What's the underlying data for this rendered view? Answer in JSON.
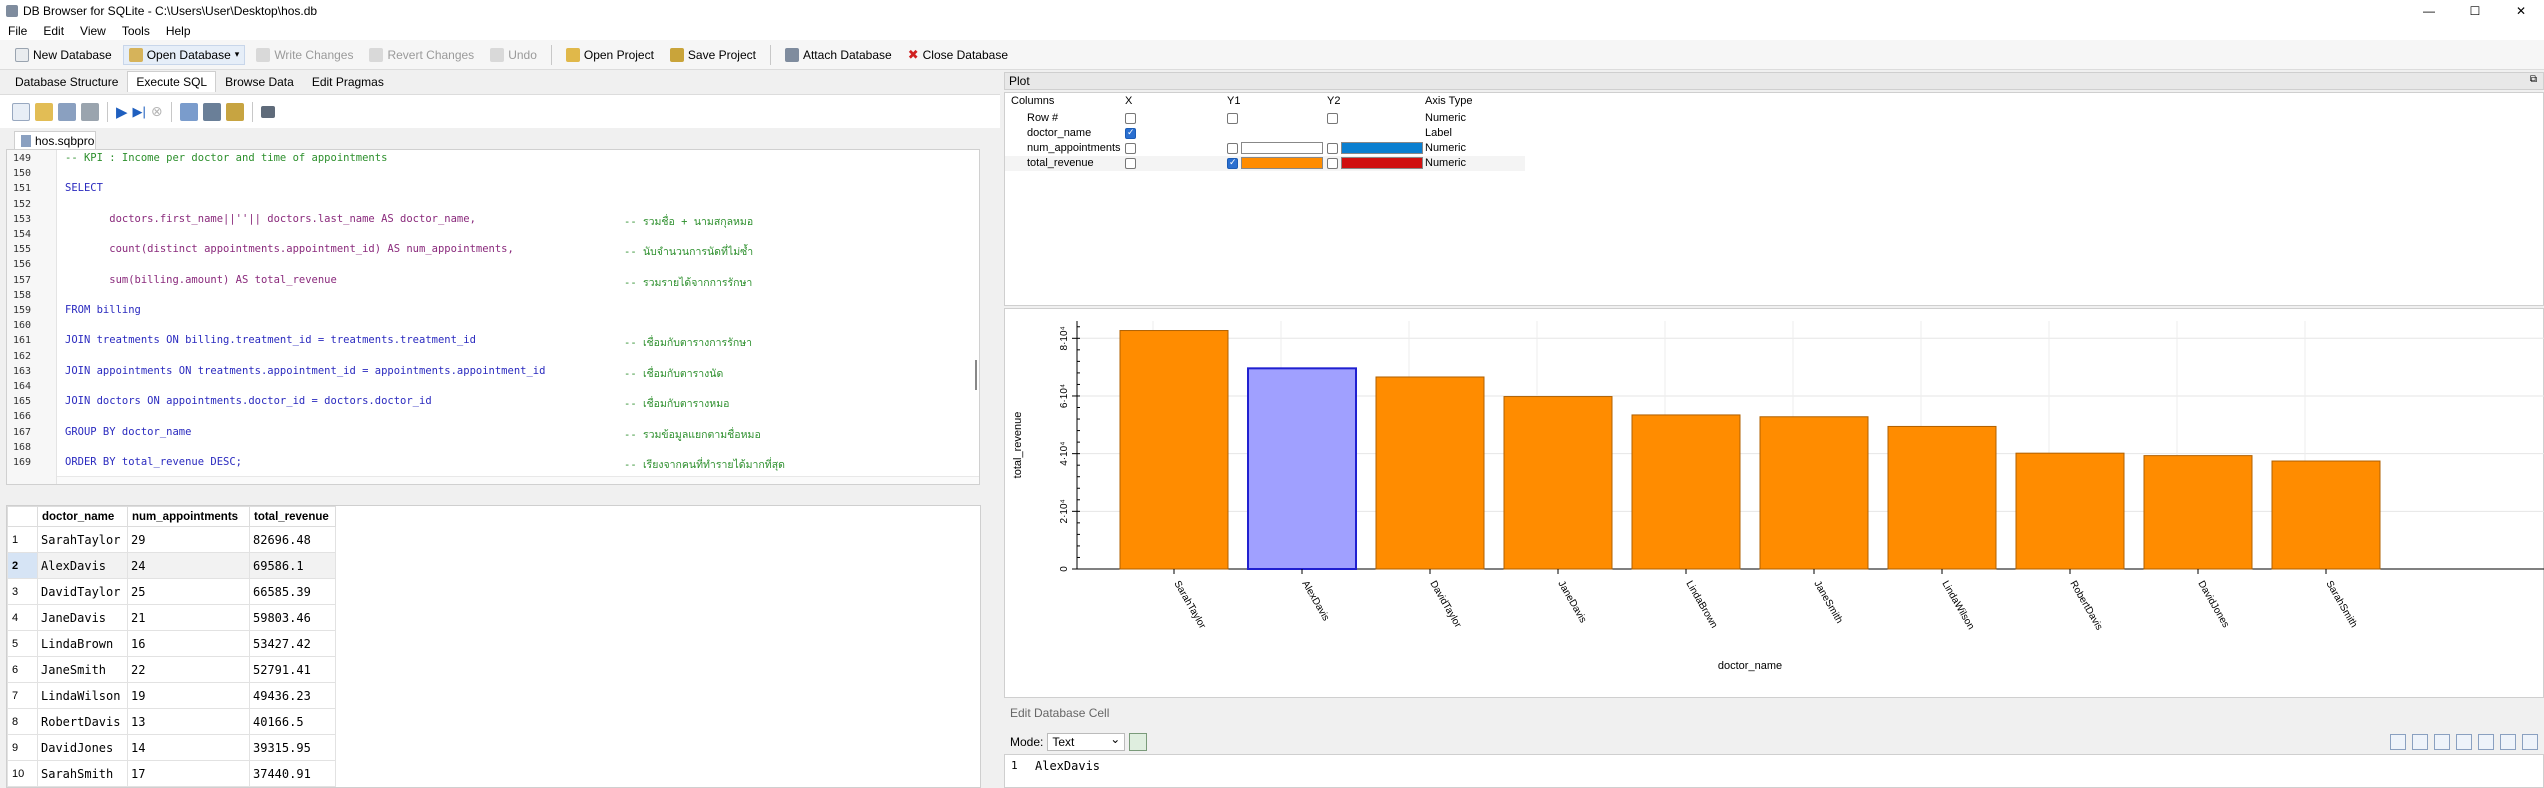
{
  "window": {
    "title": "DB Browser for SQLite - C:\\Users\\User\\Desktop\\hos.db",
    "controls": [
      "—",
      "☐",
      "✕"
    ]
  },
  "menu": [
    "File",
    "Edit",
    "View",
    "Tools",
    "Help"
  ],
  "toolbar": {
    "new_database": "New Database",
    "open_database": "Open Database",
    "write_changes": "Write Changes",
    "revert_changes": "Revert Changes",
    "undo": "Undo",
    "open_project": "Open Project",
    "save_project": "Save Project",
    "attach_database": "Attach Database",
    "close_database": "Close Database"
  },
  "tabs": [
    "Database Structure",
    "Execute SQL",
    "Browse Data",
    "Edit Pragmas"
  ],
  "active_tab": "Execute SQL",
  "sql_file": "hos.sqbpro",
  "editor": {
    "line_numbers": [
      "149",
      "150",
      "151",
      "152",
      "153",
      "154",
      "155",
      "156",
      "157",
      "158",
      "159",
      "160",
      "161",
      "162",
      "163",
      "164",
      "165",
      "166",
      "167",
      "168",
      "169"
    ],
    "lines": [
      {
        "text": "-- KPI : Income per doctor and time of appointments",
        "cls": "c-cmt",
        "comment": ""
      },
      {
        "text": "",
        "cls": "",
        "comment": ""
      },
      {
        "text": "SELECT",
        "cls": "c-kw",
        "comment": ""
      },
      {
        "text": "",
        "cls": "",
        "comment": ""
      },
      {
        "text": "       doctors.first_name||''|| doctors.last_name AS doctor_name,",
        "cls": "c-id",
        "comment": "-- รวมชื่อ + นามสกุลหมอ"
      },
      {
        "text": "",
        "cls": "",
        "comment": ""
      },
      {
        "text": "       count(distinct appointments.appointment_id) AS num_appointments,",
        "cls": "c-id",
        "comment": "-- นับจำนวนการนัดที่ไม่ซ้ำ"
      },
      {
        "text": "",
        "cls": "",
        "comment": ""
      },
      {
        "text": "       sum(billing.amount) AS total_revenue",
        "cls": "c-id",
        "comment": "-- รวมรายได้จากการรักษา"
      },
      {
        "text": "",
        "cls": "",
        "comment": ""
      },
      {
        "text": "FROM billing",
        "cls": "c-kw",
        "comment": ""
      },
      {
        "text": "",
        "cls": "",
        "comment": ""
      },
      {
        "text": "JOIN treatments ON billing.treatment_id = treatments.treatment_id",
        "cls": "c-kw",
        "comment": "-- เชื่อมกับตารางการรักษา"
      },
      {
        "text": "",
        "cls": "",
        "comment": ""
      },
      {
        "text": "JOIN appointments ON treatments.appointment_id = appointments.appointment_id",
        "cls": "c-kw",
        "comment": "-- เชื่อมกับตารางนัด"
      },
      {
        "text": "",
        "cls": "",
        "comment": ""
      },
      {
        "text": "JOIN doctors ON appointments.doctor_id = doctors.doctor_id",
        "cls": "c-kw",
        "comment": "-- เชื่อมกับตารางหมอ"
      },
      {
        "text": "",
        "cls": "",
        "comment": ""
      },
      {
        "text": "GROUP BY doctor_name",
        "cls": "c-kw",
        "comment": "-- รวมข้อมูลแยกตามชื่อหมอ"
      },
      {
        "text": "",
        "cls": "",
        "comment": ""
      },
      {
        "text": "ORDER BY total_revenue DESC;",
        "cls": "c-kw",
        "comment": "-- เรียงจากคนที่ทำรายได้มากที่สุด"
      }
    ]
  },
  "results": {
    "columns": [
      "doctor_name",
      "num_appointments",
      "total_revenue"
    ],
    "rows": [
      [
        "1",
        "SarahTaylor",
        "29",
        "82696.48"
      ],
      [
        "2",
        "AlexDavis",
        "24",
        "69586.1"
      ],
      [
        "3",
        "DavidTaylor",
        "25",
        "66585.39"
      ],
      [
        "4",
        "JaneDavis",
        "21",
        "59803.46"
      ],
      [
        "5",
        "LindaBrown",
        "16",
        "53427.42"
      ],
      [
        "6",
        "JaneSmith",
        "22",
        "52791.41"
      ],
      [
        "7",
        "LindaWilson",
        "19",
        "49436.23"
      ],
      [
        "8",
        "RobertDavis",
        "13",
        "40166.5"
      ],
      [
        "9",
        "DavidJones",
        "14",
        "39315.95"
      ],
      [
        "10",
        "SarahSmith",
        "17",
        "37440.91"
      ]
    ],
    "selected_row": 2
  },
  "plot": {
    "title": "Plot",
    "headers": [
      "Columns",
      "X",
      "Y1",
      "Y2",
      "Axis Type"
    ],
    "columns": [
      {
        "name": "Row #",
        "x": false,
        "y1": false,
        "y2": false,
        "axis_type": "Numeric",
        "y1_color": "",
        "y2_color": ""
      },
      {
        "name": "doctor_name",
        "x": true,
        "y1": null,
        "y2": null,
        "axis_type": "Label",
        "y1_color": "",
        "y2_color": ""
      },
      {
        "name": "num_appointments",
        "x": false,
        "y1": false,
        "y2": false,
        "axis_type": "Numeric",
        "y1_color": "#ffffff",
        "y2_color": "#0a7fd0"
      },
      {
        "name": "total_revenue",
        "x": false,
        "y1": true,
        "y2": false,
        "axis_type": "Numeric",
        "y1_color": "#ff8c00",
        "y2_color": "#d01010"
      }
    ]
  },
  "chart_data": {
    "type": "bar",
    "categories": [
      "SarahTaylor",
      "AlexDavis",
      "DavidTaylor",
      "JaneDavis",
      "LindaBrown",
      "JaneSmith",
      "LindaWilson",
      "RobertDavis",
      "DavidJones",
      "SarahSmith"
    ],
    "values": [
      82696.48,
      69586.1,
      66585.39,
      59803.46,
      53427.42,
      52791.41,
      49436.23,
      40166.5,
      39315.95,
      37440.91
    ],
    "xlabel": "doctor_name",
    "ylabel": "total_revenue",
    "ytick_labels": [
      "0",
      "2·10⁴",
      "4·10⁴",
      "6·10⁴",
      "8·10⁴"
    ],
    "yticks": [
      0,
      20000,
      40000,
      60000,
      80000
    ],
    "ylim": [
      0,
      86000
    ],
    "bar_color": "#ff8c00",
    "selected_bar": "AlexDavis",
    "selected_color": "#a0a0ff",
    "grid": true
  },
  "edit_cell": {
    "title": "Edit Database Cell",
    "mode_label": "Mode:",
    "mode_value": "Text",
    "line_no": "1",
    "value": "AlexDavis"
  }
}
